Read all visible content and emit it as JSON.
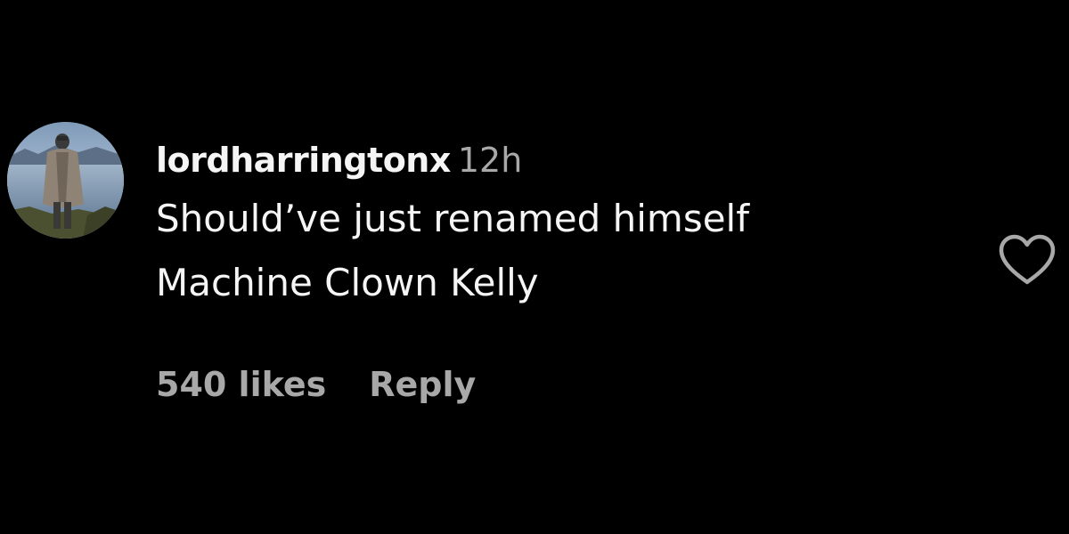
{
  "comment": {
    "username": "lordharringtonx",
    "timestamp": "12h",
    "text_lines": [
      "Should’ve just renamed himself",
      "Machine Clown Kelly"
    ],
    "likes": "540 likes",
    "reply_label": "Reply"
  },
  "icons": {
    "like": "heart-outline-icon",
    "avatar": "user-avatar-photo"
  },
  "colors": {
    "background": "#000000",
    "primary_text": "#f5f5f5",
    "secondary_text": "#a8a8a8"
  }
}
